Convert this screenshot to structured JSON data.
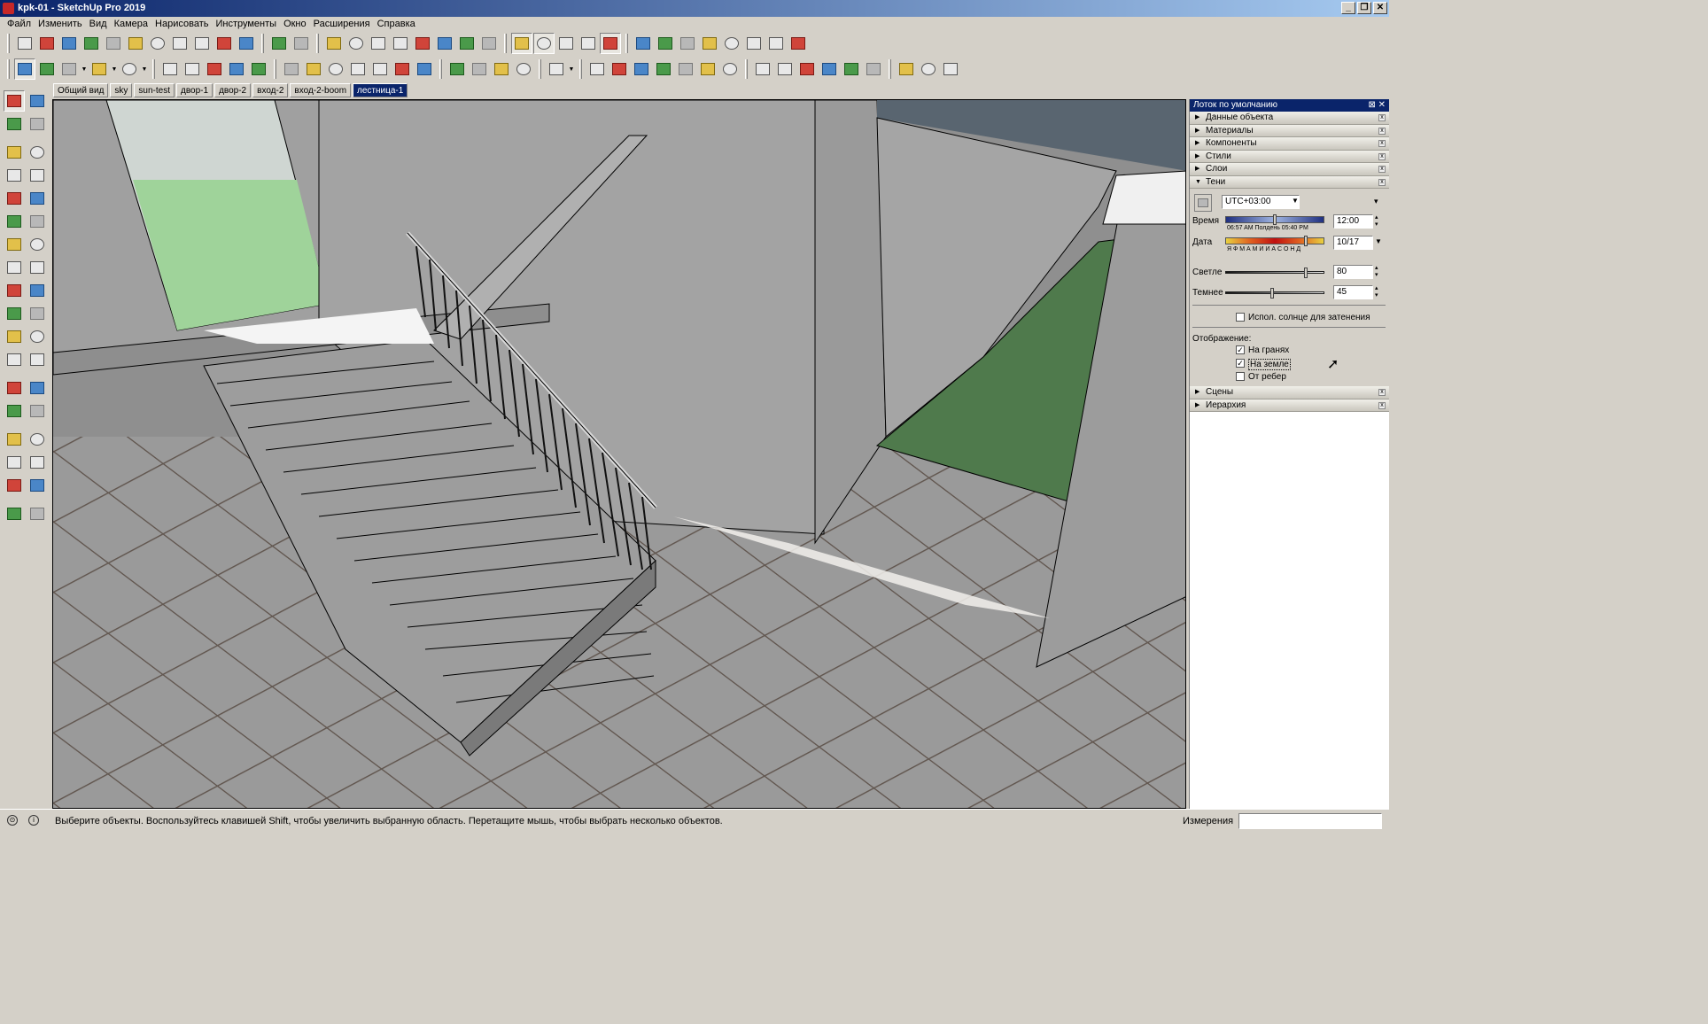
{
  "window": {
    "title": "kpk-01 - SketchUp Pro 2019",
    "controls": [
      "_",
      "❐",
      "✕"
    ]
  },
  "menu": [
    "Файл",
    "Изменить",
    "Вид",
    "Камера",
    "Нарисовать",
    "Инструменты",
    "Окно",
    "Расширения",
    "Справка"
  ],
  "scene_tabs": {
    "items": [
      "Общий вид",
      "sky",
      "sun-test",
      "двор-1",
      "двор-2",
      "вход-2",
      "вход-2-boom",
      "лестница-1"
    ],
    "active_index": 7
  },
  "tray": {
    "title": "Лоток по умолчанию",
    "panels_top": [
      {
        "label": "Данные объекта",
        "expanded": false
      },
      {
        "label": "Материалы",
        "expanded": false
      },
      {
        "label": "Компоненты",
        "expanded": false
      },
      {
        "label": "Стили",
        "expanded": false
      },
      {
        "label": "Слои",
        "expanded": false
      },
      {
        "label": "Тени",
        "expanded": true
      }
    ],
    "shadows": {
      "timezone": "UTC+03:00",
      "time_label": "Время",
      "time_value": "12:00",
      "time_ticks": "06:57 AM    Полдень    05:40 PM",
      "date_label": "Дата",
      "date_value": "10/17",
      "date_ticks": "Я Ф М А М И И А С О Н Д",
      "light_label": "Светле",
      "light_value": "80",
      "dark_label": "Темнее",
      "dark_value": "45",
      "use_sun_label": "Испол. солнце для затенения",
      "use_sun_checked": false,
      "display_label": "Отображение:",
      "on_faces_label": "На гранях",
      "on_faces_checked": true,
      "on_ground_label": "На земле",
      "on_ground_checked": true,
      "from_edges_label": "От ребер",
      "from_edges_checked": false
    },
    "panels_bottom": [
      {
        "label": "Сцены",
        "expanded": false
      },
      {
        "label": "Иерархия",
        "expanded": false
      }
    ]
  },
  "status": {
    "text": "Выберите объекты. Воспользуйтесь клавишей Shift, чтобы увеличить выбранную область. Перетащите мышь, чтобы выбрать несколько объектов.",
    "measurements_label": "Измерения",
    "measurements_value": ""
  },
  "icons": {
    "toolbar1": [
      "view-top-icon",
      "view-front-icon",
      "view-right-icon",
      "view-back-icon",
      "view-left-icon",
      "view-bottom-icon",
      "view-iso-icon",
      "section-plane-icon",
      "section-fill-icon",
      "section-cut-icon",
      "section-display-icon",
      "stairs-icon",
      "axes-icon",
      "tape-icon",
      "protractor-icon",
      "materials-icon",
      "grid-icon",
      "texture-icon",
      "paint-icon",
      "sandbox-icon",
      "terrain-icon",
      "orbit-icon",
      "xray-icon",
      "back-edges-icon",
      "wireframe-icon",
      "shaded-icon",
      "dimension-icon",
      "text-icon",
      "3d-text-icon",
      "flip-icon",
      "move-icon",
      "green-arrows-icon",
      "red-x-icon",
      "green-arrows2-icon"
    ],
    "toolbar2": [
      "select-icon",
      "eraser-icon",
      "pencil-icon",
      "arc-icon",
      "rectangle-icon",
      "push-pull-icon",
      "offset-icon",
      "move-icon",
      "rotate-icon",
      "scale-icon",
      "tape-measure-icon",
      "text-icon",
      "paint-bucket-icon",
      "orbit-icon",
      "pan-icon",
      "zoom-icon",
      "zoom-extents-icon",
      "warehouse-icon",
      "extension-icon",
      "share-icon",
      "ruby-icon",
      "account-icon",
      "camera-icon",
      "walk-icon",
      "look-around-icon",
      "section-icon",
      "component-icon",
      "solid-icon",
      "delete-icon",
      "house-icon",
      "house-front-icon",
      "house-right-icon",
      "house-top-icon",
      "house-back-icon",
      "house-left-icon",
      "import-icon",
      "export-icon",
      "download-icon"
    ],
    "left": [
      "select-icon",
      "component-icon",
      "paint-bucket-icon",
      "eraser-icon",
      "line-icon",
      "freehand-icon",
      "rectangle-icon",
      "rotated-rect-icon",
      "circle-icon",
      "polygon-icon",
      "arc-icon",
      "pie-icon",
      "arc3-icon",
      "arc-tangent-icon",
      "move-icon",
      "push-pull-icon",
      "rotate-icon",
      "follow-me-icon",
      "scale-icon",
      "offset-icon",
      "tape-measure-icon",
      "dimension-icon",
      "protractor-icon",
      "text-icon",
      "axes-icon",
      "3d-text-icon",
      "orbit-icon",
      "pan-icon",
      "zoom-icon",
      "zoom-window-icon",
      "zoom-extents-icon",
      "previous-view-icon",
      "position-camera-icon",
      "look-around-icon",
      "walk-icon",
      "section-plane-icon"
    ]
  },
  "colors": {
    "title_active": "#0a246a",
    "chrome": "#d4d0c8",
    "grass": "#4f7a4c",
    "sky": "#596570",
    "wall": "#9c9c9c"
  }
}
